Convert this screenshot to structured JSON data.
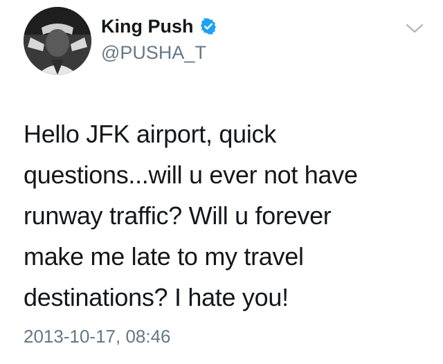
{
  "author": {
    "display_name": "King Push",
    "handle": "@PUSHA_T",
    "verified": true
  },
  "tweet": {
    "text": "Hello JFK airport, quick questions...will u ever not have runway traffic? Will u forever make me late to my travel destinations? I hate you!",
    "lines": [
      "Hello JFK airport, quick",
      "questions...will u ever not have",
      "runway traffic? Will u forever",
      "make me late to my travel",
      "destinations? I hate you!"
    ],
    "timestamp": "2013-10-17, 08:46"
  },
  "icons": {
    "verified": "verified-badge-icon",
    "menu": "chevron-down-icon"
  },
  "colors": {
    "text": "#14171a",
    "secondary": "#657786",
    "verified": "#1da1f2",
    "chevron": "#aab8c2"
  }
}
